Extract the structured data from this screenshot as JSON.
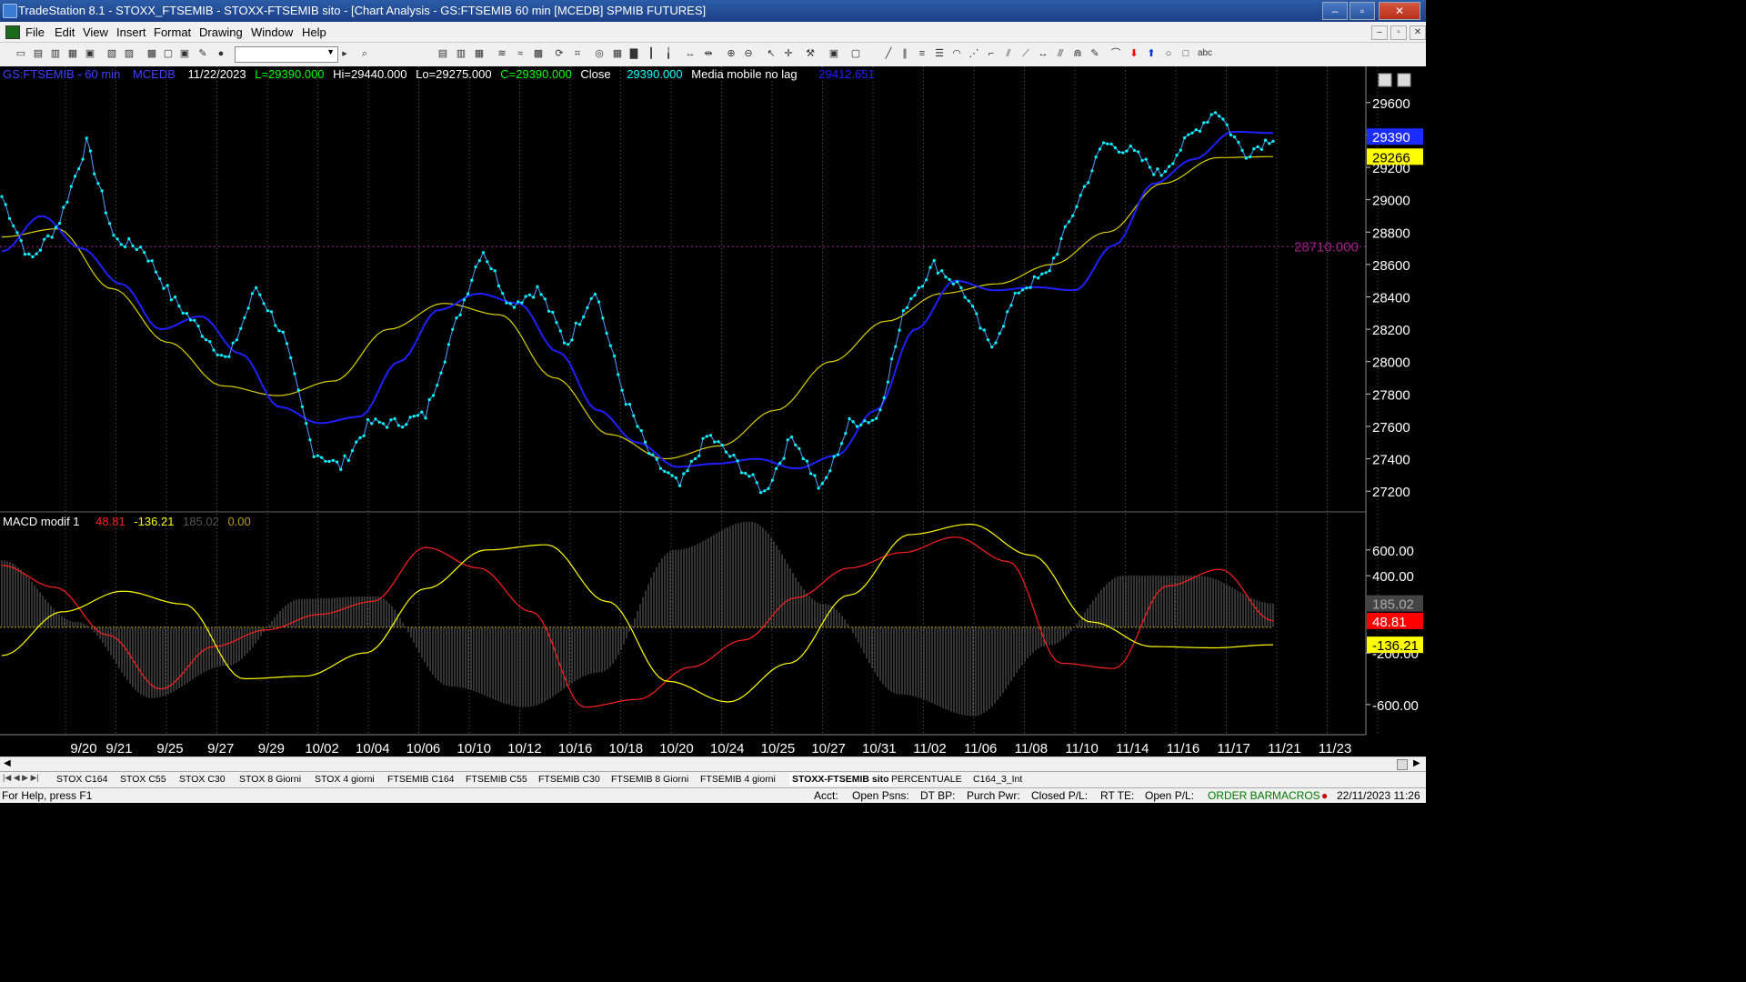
{
  "window": {
    "title": "TradeStation 8.1 - STOXX_FTSEMIB - STOXX-FTSEMIB sito - [Chart Analysis - GS:FTSEMIB  60 min  [MCEDB] SPMIB FUTURES]",
    "minimize": "–",
    "maximize": "▫",
    "close": "✕"
  },
  "menu": {
    "items": [
      "File",
      "Edit",
      "View",
      "Insert",
      "Format",
      "Drawing",
      "Window",
      "Help"
    ],
    "mdi": [
      "–",
      "▫",
      "✕"
    ]
  },
  "toolbar": {
    "combo_value": ""
  },
  "chart_header": {
    "symbol": "GS:FTSEMIB - 60 min",
    "exchange": "MCEDB",
    "date": "11/22/2023",
    "last": "L=29390.000",
    "high": "Hi=29440.000",
    "low": "Lo=29275.000",
    "close_val": "C=29390.000",
    "close_label": "Close",
    "close_num": "29390.000",
    "ma_label": "Media mobile no lag",
    "ma_value": "29412.651",
    "colors": {
      "symbol": "#4040ff",
      "exchange": "#4040ff",
      "date": "#ffffff",
      "last": "#00ff00",
      "high": "#ffffff",
      "low": "#ffffff",
      "close_val": "#00ff00",
      "close_label": "#ffffff",
      "close_num": "#00ffff",
      "ma_label": "#ffffff",
      "ma_value": "#2020ff"
    }
  },
  "macd_header": {
    "label": "MACD modif 1",
    "v1": "48.81",
    "v2": "-136.21",
    "v3": "185.02",
    "v4": "0.00",
    "colors": {
      "label": "#ffffff",
      "v1": "#ff2020",
      "v2": "#ffff00",
      "v3": "#555555",
      "v4": "#b8a000"
    }
  },
  "price_axis": {
    "ticks": [
      "29600",
      "29400",
      "29200",
      "29000",
      "28800",
      "28600",
      "28400",
      "28200",
      "28000",
      "27800",
      "27600",
      "27400",
      "27200"
    ],
    "badges": [
      {
        "text": "29390",
        "bg": "#1a2cff",
        "fg": "#ffffff"
      },
      {
        "text": "29266",
        "bg": "#ffff00",
        "fg": "#000000"
      }
    ],
    "hline_label": "28710.000"
  },
  "macd_axis": {
    "ticks": [
      "600.00",
      "400.00",
      "-200.00",
      "-600.00"
    ],
    "badges": [
      {
        "text": "185.02",
        "bg": "#444444",
        "fg": "#aaaaaa"
      },
      {
        "text": "48.81",
        "bg": "#ff0000",
        "fg": "#ffffff"
      },
      {
        "text": "-136.21",
        "bg": "#ffff00",
        "fg": "#000000"
      }
    ]
  },
  "date_axis": {
    "labels": [
      "9/20",
      "9/21",
      "9/25",
      "9/27",
      "9/29",
      "10/02",
      "10/04",
      "10/06",
      "10/10",
      "10/12",
      "10/16",
      "10/18",
      "10/20",
      "10/24",
      "10/25",
      "10/27",
      "10/31",
      "11/02",
      "11/06",
      "11/08",
      "11/10",
      "11/14",
      "11/16",
      "11/17",
      "11/21",
      "11/23"
    ]
  },
  "chart_data": [
    {
      "type": "line",
      "ylim": [
        27100,
        29700
      ],
      "hline": 28710,
      "series": [
        {
          "name": "Close",
          "color": "#00ffff",
          "values": [
            29020,
            28620,
            28850,
            29350,
            28750,
            28700,
            28400,
            28200,
            28000,
            28460,
            28150,
            27450,
            27350,
            27620,
            27620,
            27670,
            28200,
            28700,
            28350,
            28450,
            28100,
            28450,
            27800,
            27400,
            27230,
            27550,
            27380,
            27190,
            27550,
            27200,
            27620,
            27650,
            28350,
            28600,
            28450,
            28080,
            28440,
            28540,
            28950,
            29350,
            29300,
            29150,
            29380,
            29560,
            29280,
            29390
          ]
        },
        {
          "color": "#2020ff",
          "values": [
            28680,
            28900,
            28700,
            28480,
            28200,
            28280,
            28050,
            27720,
            27620,
            27660,
            28000,
            28320,
            28420,
            28360,
            28060,
            27700,
            27500,
            27350,
            27370,
            27400,
            27340,
            27420,
            27700,
            28200,
            28500,
            28440,
            28460,
            28440,
            28720,
            29100,
            29250,
            29420,
            29412
          ]
        },
        {
          "name": "Media mobile no lag",
          "color": "#d8d000",
          "values": [
            28770,
            28820,
            28450,
            28120,
            27850,
            27790,
            27880,
            28200,
            28360,
            28290,
            27900,
            27550,
            27400,
            27480,
            27700,
            28000,
            28250,
            28420,
            28480,
            28600,
            28800,
            29100,
            29260,
            29266
          ]
        }
      ]
    },
    {
      "type": "bar",
      "ylim": [
        -820,
        860
      ],
      "series": [
        {
          "name": "MACD modif 1",
          "color": "#ff2020",
          "values": [
            480,
            310,
            -60,
            -480,
            -150,
            -20,
            100,
            200,
            620,
            460,
            120,
            -620,
            -560,
            -310,
            -100,
            230,
            460,
            580,
            700,
            510,
            -280,
            -320,
            320,
            450,
            48.81
          ]
        },
        {
          "color": "#ffff00",
          "values": [
            -220,
            120,
            280,
            180,
            -400,
            -380,
            -200,
            300,
            600,
            640,
            200,
            -420,
            -580,
            -280,
            250,
            720,
            800,
            560,
            40,
            -150,
            -160,
            -136.21
          ]
        },
        {
          "color": "#555555",
          "values": [
            520,
            40,
            -550,
            -300,
            220,
            240,
            -460,
            -620,
            -350,
            600,
            820,
            180,
            -520,
            -690,
            -140,
            400,
            400,
            185.02
          ]
        },
        {
          "color": "#b8a000",
          "values": [
            0.0
          ]
        }
      ]
    }
  ],
  "tabs": [
    "STOX C164",
    "STOX C55",
    "STOX  C30",
    "STOX  8 Giorni",
    "STOX 4 giorni",
    "FTSEMIB C164",
    "FTSEMIB C55",
    "FTSEMIB C30",
    "FTSEMIB  8 Giorni",
    "FTSEMIB  4 giorni",
    "STOXX-FTSEMIB sito",
    "PERCENTUALE",
    "C164_3_Int"
  ],
  "status": {
    "help": "For Help, press F1",
    "acct": "Acct:",
    "open_psns": "Open Psns:",
    "dt_bp": "DT BP:",
    "purch_pwr": "Purch Pwr:",
    "closed_pl": "Closed P/L:",
    "rt_te": "RT TE:",
    "open_pl": "Open P/L:",
    "order_bar": "ORDER BAR",
    "macros": "MACROS",
    "datetime": "22/11/2023 11:26"
  }
}
